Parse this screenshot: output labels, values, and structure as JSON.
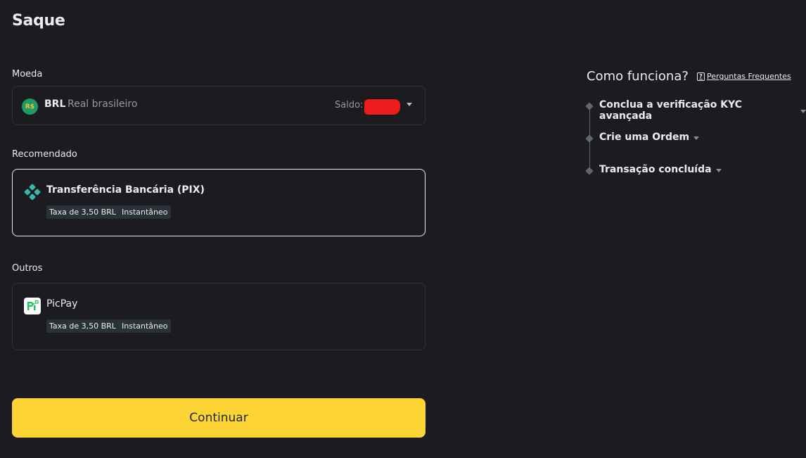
{
  "page": {
    "title": "Saque"
  },
  "currency": {
    "section_label": "Moeda",
    "icon_text": "R$",
    "code": "BRL",
    "name": "Real brasileiro",
    "balance_label": "Saldo:"
  },
  "recommended": {
    "section_label": "Recomendado",
    "method": {
      "name": "Transferência Bancária (PIX)",
      "fee": "Taxa de 3,50 BRL",
      "speed": "Instantâneo",
      "icon": "pix-icon"
    }
  },
  "others": {
    "section_label": "Outros",
    "method": {
      "name": "PicPay",
      "fee": "Taxa de 3,50 BRL",
      "speed": "Instantâneo",
      "icon": "picpay-icon"
    }
  },
  "continue_label": "Continuar",
  "how_it_works": {
    "title": "Como funciona?",
    "faq_label": "Perguntas Frequentes",
    "steps": [
      {
        "label": "Conclua a verificação KYC avançada"
      },
      {
        "label": "Crie uma Ordem"
      },
      {
        "label": "Transação concluída"
      }
    ]
  },
  "colors": {
    "background": "#1b1b20",
    "accent": "#fcd535",
    "pix": "#32bcad",
    "picpay": "#21c25e",
    "redaction": "#ec1c1c"
  }
}
